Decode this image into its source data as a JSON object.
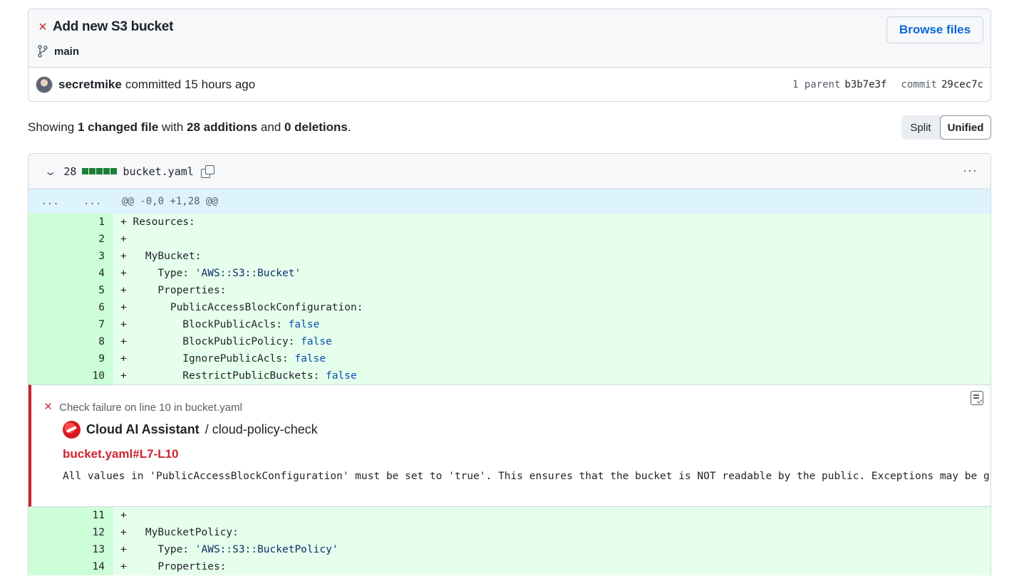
{
  "commit": {
    "title": "Add new S3 bucket",
    "branch": "main",
    "browse_label": "Browse files",
    "author": "secretmike",
    "action": "committed 15 hours ago",
    "parent_label": "1 parent",
    "parent_sha": "b3b7e3f",
    "commit_label": "commit",
    "commit_sha": "29cec7c"
  },
  "summary": {
    "prefix": "Showing ",
    "files": "1 changed file",
    "mid1": " with ",
    "additions": "28 additions",
    "mid2": " and ",
    "deletions": "0 deletions",
    "suffix": "."
  },
  "view_toggle": {
    "split": "Split",
    "unified": "Unified",
    "selected": "Unified"
  },
  "file": {
    "count": "28",
    "filename": "bucket.yaml",
    "hunk_left": "...",
    "hunk_right": "...",
    "hunk_header": "@@ -0,0 +1,28 @@",
    "lines_before": [
      {
        "num": "1",
        "text": "+ Resources:"
      },
      {
        "num": "2",
        "text": "+"
      },
      {
        "num": "3",
        "text": "+   MyBucket:"
      },
      {
        "num": "4",
        "text": "+     Type: 'AWS::S3::Bucket'"
      },
      {
        "num": "5",
        "text": "+     Properties:"
      },
      {
        "num": "6",
        "text": "+       PublicAccessBlockConfiguration:"
      },
      {
        "num": "7",
        "text": "+         BlockPublicAcls: false"
      },
      {
        "num": "8",
        "text": "+         BlockPublicPolicy: false"
      },
      {
        "num": "9",
        "text": "+         IgnorePublicAcls: false"
      },
      {
        "num": "10",
        "text": "+         RestrictPublicBuckets: false"
      }
    ],
    "lines_after": [
      {
        "num": "11",
        "text": "+"
      },
      {
        "num": "12",
        "text": "+   MyBucketPolicy:"
      },
      {
        "num": "13",
        "text": "+     Type: 'AWS::S3::BucketPolicy'"
      },
      {
        "num": "14",
        "text": "+     Properties:"
      }
    ]
  },
  "annotation": {
    "heading": "Check failure on line 10 in bucket.yaml",
    "tool_name": "Cloud AI Assistant",
    "tool_check": " / cloud-policy-check",
    "link": "bucket.yaml#L7-L10",
    "message": "All values in 'PublicAccessBlockConfiguration' must be set to 'true'. This ensures that the bucket is NOT readable by the public. Exceptions may be gra"
  },
  "colors": {
    "failure": "#cf222e",
    "link": "#0969da",
    "addition_bg": "#e6ffec",
    "addition_num_bg": "#ccffd8",
    "hunk_bg": "#ddf4ff"
  }
}
